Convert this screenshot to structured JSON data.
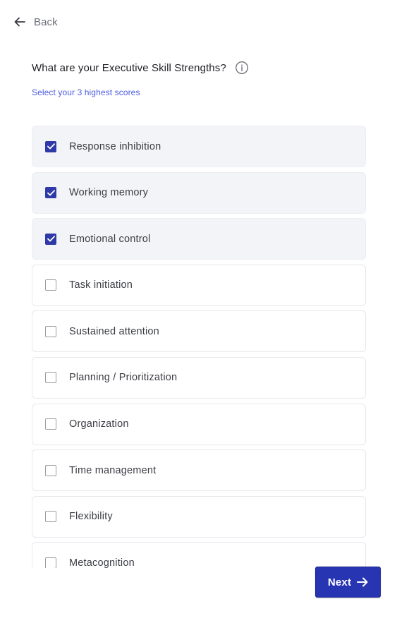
{
  "nav": {
    "back_label": "Back",
    "back_icon": "arrow-left-icon"
  },
  "question": {
    "title": "What are your Executive Skill Strengths?",
    "info_icon": "info-icon",
    "hint": "Select your 3 highest scores"
  },
  "options": [
    {
      "label": "Response inhibition",
      "checked": true
    },
    {
      "label": "Working memory",
      "checked": true
    },
    {
      "label": "Emotional control",
      "checked": true
    },
    {
      "label": "Task initiation",
      "checked": false
    },
    {
      "label": "Sustained attention",
      "checked": false
    },
    {
      "label": "Planning / Prioritization",
      "checked": false
    },
    {
      "label": "Organization",
      "checked": false
    },
    {
      "label": "Time management",
      "checked": false
    },
    {
      "label": "Flexibility",
      "checked": false
    },
    {
      "label": "Metacognition",
      "checked": false
    }
  ],
  "footer": {
    "next_label": "Next",
    "next_icon": "arrow-right-icon"
  },
  "colors": {
    "accent": "#2735b3",
    "hint": "#4a5ae0",
    "selected_bg": "#f3f4f8",
    "border": "#e6e8ec"
  }
}
